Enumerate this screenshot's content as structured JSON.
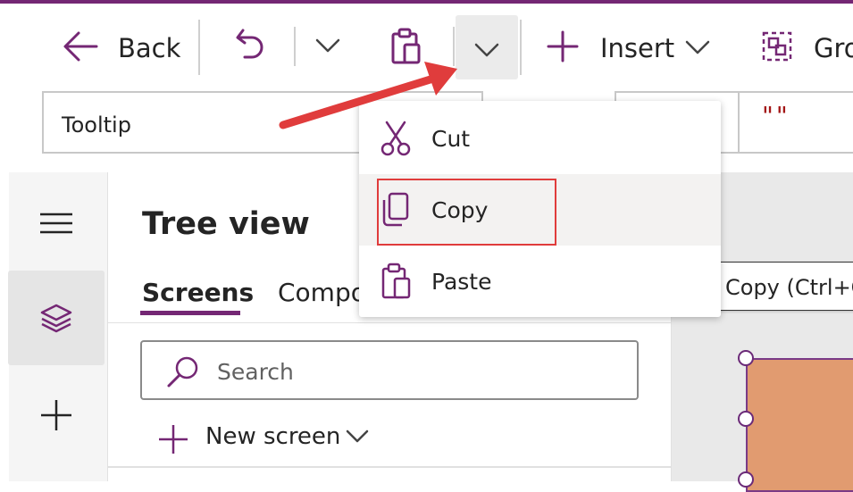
{
  "toolbar": {
    "back_label": "Back",
    "insert_label": "Insert",
    "group_label": "Gro"
  },
  "formula_bar": {
    "property": "Tooltip",
    "formula": "\"\""
  },
  "tree_view": {
    "title": "Tree view",
    "tabs": [
      {
        "label": "Screens",
        "active": true
      },
      {
        "label": "Compo",
        "active": false
      }
    ],
    "search_placeholder": "Search",
    "new_screen_label": "New screen"
  },
  "context_menu": {
    "items": [
      {
        "label": "Cut",
        "icon": "scissors-icon"
      },
      {
        "label": "Copy",
        "icon": "copy-icon",
        "highlighted": true
      },
      {
        "label": "Paste",
        "icon": "paste-icon"
      }
    ]
  },
  "tooltip": {
    "text": "Copy (Ctrl+C)"
  },
  "colors": {
    "accent": "#742774",
    "annotation_red": "#e03c3c",
    "shape_fill": "#e19b70"
  }
}
